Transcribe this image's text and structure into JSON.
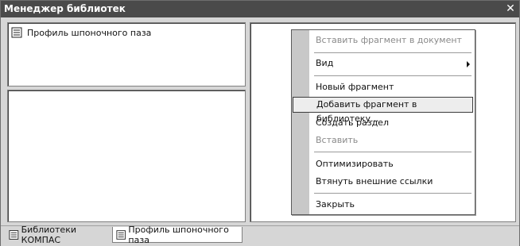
{
  "window": {
    "title": "Менеджер библиотек",
    "close_icon": "close-icon"
  },
  "tree": {
    "items": [
      {
        "label": "Профиль шпоночного паза",
        "icon": "library-icon"
      }
    ]
  },
  "context_menu": {
    "items": [
      {
        "label": "Вставить фрагмент в документ",
        "disabled": true
      },
      {
        "label": "Вид",
        "has_submenu": true
      },
      {
        "label": "Новый фрагмент"
      },
      {
        "label": "Добавить фрагмент в библиотеку...",
        "highlighted": true
      },
      {
        "label": "Создать раздел"
      },
      {
        "label": "Вставить",
        "disabled": true
      },
      {
        "label": "Оптимизировать"
      },
      {
        "label": "Втянуть внешние ссылки"
      },
      {
        "label": "Закрыть"
      }
    ]
  },
  "tabs": [
    {
      "label": "Библиотеки КОМПАС",
      "icon": "library-icon"
    },
    {
      "label": "Профиль шпоночного паза",
      "icon": "library-icon",
      "active": true
    }
  ]
}
